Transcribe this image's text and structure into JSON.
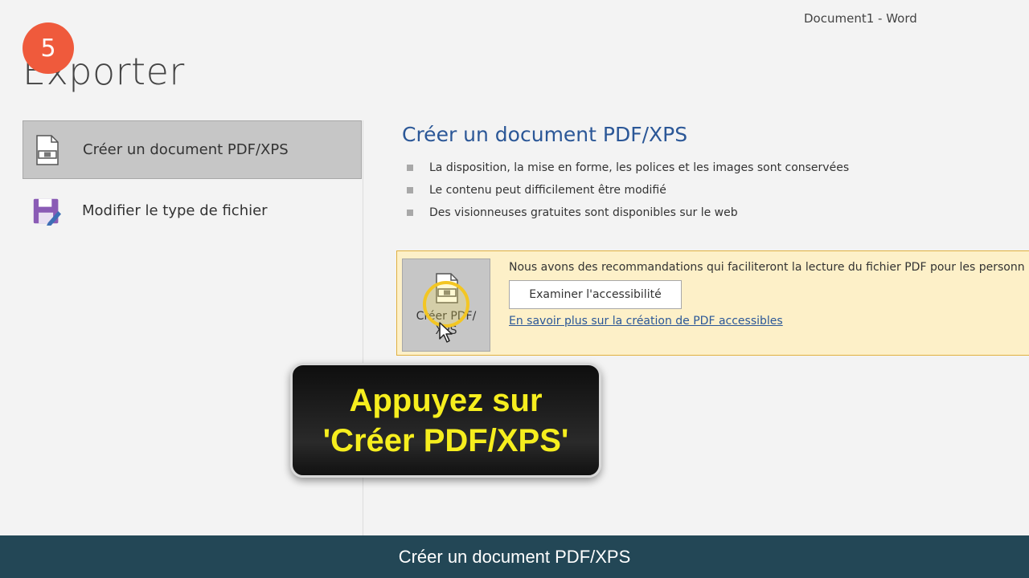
{
  "window": {
    "title": "Document1  -  Word"
  },
  "tutorial": {
    "step_number": "5"
  },
  "page": {
    "title": "Exporter"
  },
  "sidebar": {
    "items": [
      {
        "label": "Créer un document PDF/XPS",
        "icon": "pdf-document-icon",
        "selected": true
      },
      {
        "label": "Modifier le type de fichier",
        "icon": "save-edit-icon",
        "selected": false
      }
    ]
  },
  "main": {
    "section_title": "Créer un document PDF/XPS",
    "bullets": [
      "La disposition, la mise en forme, les polices et les images sont conservées",
      "Le contenu peut difficilement être modifié",
      "Des visionneuses gratuites sont disponibles sur le web"
    ],
    "create_button_label": "Créer PDF/ XPS",
    "recommendation_text": "Nous avons des recommandations qui faciliteront la lecture du fichier PDF pour les personn",
    "accessibility_button_label": "Examiner l'accessibilité",
    "learn_more_link": "En savoir plus sur la création de PDF accessibles"
  },
  "callout": {
    "line1": "Appuyez sur",
    "line2": "'Créer PDF/XPS'"
  },
  "caption": {
    "text": "Créer un document PDF/XPS"
  },
  "colors": {
    "accent_blue": "#2b5797",
    "badge": "#ef5a3c",
    "callout_text": "#f6ee1e",
    "caption_bar": "#234756",
    "panel_bg": "#fdf0c8"
  }
}
